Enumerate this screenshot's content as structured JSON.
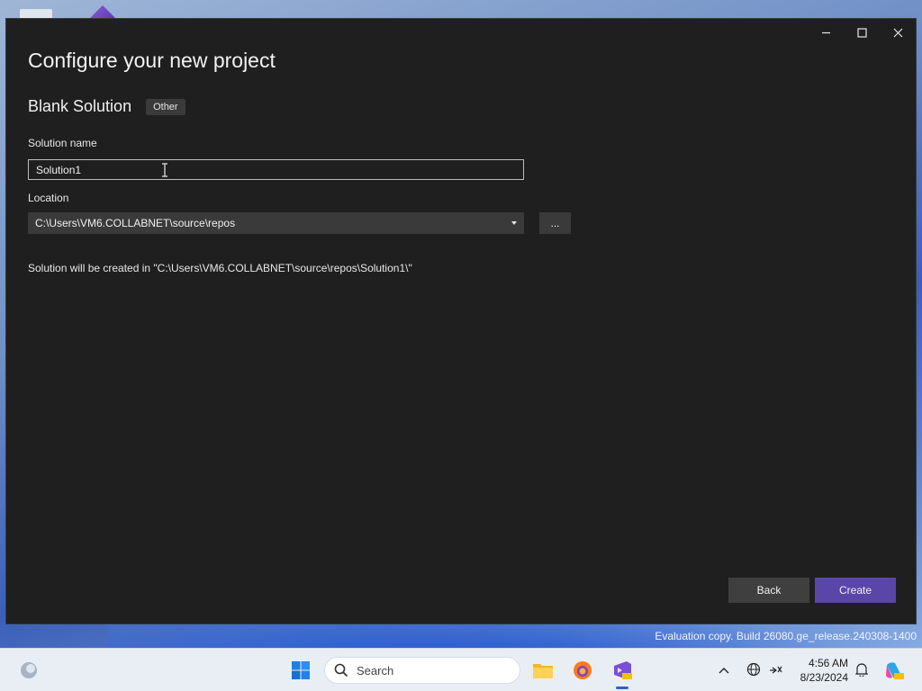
{
  "window": {
    "controls": {
      "minimize": "—",
      "maximize": "☐",
      "close": "✕"
    },
    "page_title": "Configure your new project",
    "template": {
      "name": "Blank Solution",
      "tag": "Other"
    },
    "solution_name": {
      "label": "Solution name",
      "value": "Solution1"
    },
    "location": {
      "label": "Location",
      "value": "C:\\Users\\VM6.COLLABNET\\source\\repos",
      "browse_label": "..."
    },
    "info_text": "Solution will be created in \"C:\\Users\\VM6.COLLABNET\\source\\repos\\Solution1\\\"",
    "buttons": {
      "back": "Back",
      "create": "Create"
    }
  },
  "watermark": {
    "line": "Evaluation copy. Build 26080.ge_release.240308-1400"
  },
  "taskbar": {
    "search_placeholder": "Search",
    "time": "4:56 AM",
    "date": "8/23/2024",
    "icons": [
      "widgets-icon",
      "start-icon",
      "search-icon",
      "file-explorer-icon",
      "firefox-icon",
      "visual-studio-preview-icon",
      "chevron-up-icon",
      "network-icon",
      "accessibility-icon",
      "notification-bell-icon",
      "copilot-icon"
    ]
  },
  "colors": {
    "window_bg": "#1f1f1f",
    "create_accent": "#5a45a8",
    "taskbar_bg": "#e9eef5"
  }
}
